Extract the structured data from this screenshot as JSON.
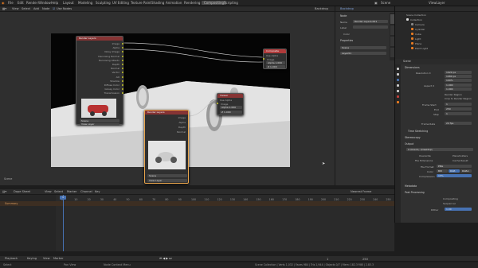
{
  "menu": {
    "items": [
      "File",
      "Edit",
      "Render",
      "Window",
      "Help"
    ],
    "workspaces": [
      "Layout",
      "Modeling",
      "Sculpting",
      "UV Editing",
      "Texture Paint",
      "Shading",
      "Animation",
      "Rendering",
      "Compositing",
      "Scripting"
    ],
    "active": "Compositing",
    "scene": "Scene",
    "view_layer": "ViewLayer"
  },
  "editor_header": {
    "items": [
      "View",
      "Select",
      "Add",
      "Node"
    ],
    "use_nodes": "Use Nodes",
    "backdrop": "Backdrop"
  },
  "nodes": {
    "render_layers": {
      "title": "Render Layers",
      "outputs": [
        "Image",
        "Alpha",
        "Noisy Image",
        "Denoising Normal",
        "Denoising Albedo",
        "Depth",
        "Normal",
        "Vector",
        "AO",
        "Shadow",
        "Diffuse Color",
        "Glossy Color",
        "Transmission"
      ],
      "scene": "Scene",
      "layer": "View Layer"
    },
    "composite": {
      "title": "Composite",
      "use_alpha": "Use Alpha",
      "inputs": [
        "Image",
        "Alpha",
        "Z"
      ],
      "alpha_value": "1.000",
      "z_value": "1.000"
    },
    "render_layers_2": {
      "title": "Render Layers",
      "outputs": [
        "Image",
        "Alpha",
        "Depth",
        "Normal"
      ],
      "scene": "Scene",
      "layer": "View Layer"
    },
    "viewer": {
      "title": "Viewer",
      "use_alpha": "Use Alpha",
      "inputs": [
        "Image",
        "Alpha",
        "Z"
      ],
      "alpha_value": "1.000",
      "z_value": "1.000"
    }
  },
  "viewport_label": "Scene",
  "node_sidebar": {
    "tabs": [
      "Node",
      "Tool",
      "View",
      "Options"
    ],
    "panel_node": "Node",
    "name_label": "Name",
    "name_value": "Render Layers.001",
    "label_label": "Label",
    "color_label": "Color",
    "properties_label": "Properties",
    "scene_value": "Scene",
    "layer_value": "Layer01"
  },
  "outliner": {
    "title": "Scene Collection",
    "items": [
      "Collection",
      "Camera",
      "Cylinder",
      "Cube",
      "Light",
      "Plane",
      "Point Light"
    ],
    "scene": "Scene"
  },
  "properties": {
    "dimensions": "Dimensions",
    "res_x_label": "Resolution X",
    "res_x": "1920 px",
    "res_y": "1080 px",
    "res_pct": "100%",
    "aspect_label": "Aspect X",
    "aspect_x": "1.000",
    "aspect_y": "1.000",
    "render_region": "Render Region",
    "crop": "Crop to Render Region",
    "frame_start_label": "Frame Start",
    "frame_start": "1",
    "end_label": "End",
    "frame_end": "250",
    "step_label": "Step",
    "frame_step": "1",
    "frame_rate_label": "Frame Rate",
    "frame_rate": "24 fps",
    "time_stretching": "Time Stretching",
    "stereoscopy": "Stereoscopy",
    "output": "Output",
    "output_path": "C:\\Users\\...\\Desktop\\",
    "overwrite": "Overwrite",
    "placeholders": "Placeholders",
    "file_ext": "File Extensions",
    "cache_result": "Cache Result",
    "file_format_label": "File Format",
    "file_format": "PNG",
    "color_label": "Color",
    "color_bw": "BW",
    "color_rgb": "RGB",
    "color_rgba": "RGBA",
    "compression_label": "Compression",
    "compression": "15%",
    "metadata": "Metadata",
    "post_processing": "Post Processing",
    "compositing": "Compositing",
    "sequencer": "Sequencer",
    "dither_label": "Dither",
    "dither": "1.00"
  },
  "timeline": {
    "menu": [
      "Dope Sheet",
      "View",
      "Select",
      "Marker",
      "Channel",
      "Key"
    ],
    "summary": "Summary",
    "keying": "Nearest Frame",
    "current": "1",
    "start": "1",
    "end": "250",
    "ticks": [
      "0",
      "10",
      "20",
      "30",
      "40",
      "50",
      "60",
      "70",
      "80",
      "90",
      "100",
      "110",
      "120",
      "130",
      "140",
      "150",
      "160",
      "170",
      "180",
      "190",
      "200",
      "210",
      "220",
      "230",
      "240",
      "250"
    ]
  },
  "playback_bar": {
    "items": [
      "Playback",
      "Keying",
      "View",
      "Marker"
    ]
  },
  "status": {
    "left": "Select",
    "center": "Pan View",
    "right": "Node Context Menu",
    "stats": "Scene Collection | Verts 1,032 | Faces 984 | Tris 1,944 | Objects 0/7 | Mem: 182.3 MiB | 2.83.3"
  },
  "colors": {
    "node_header": "#873434",
    "composite_header": "#b03a3a",
    "accent": "#4772b3",
    "orange": "#e87b21"
  }
}
